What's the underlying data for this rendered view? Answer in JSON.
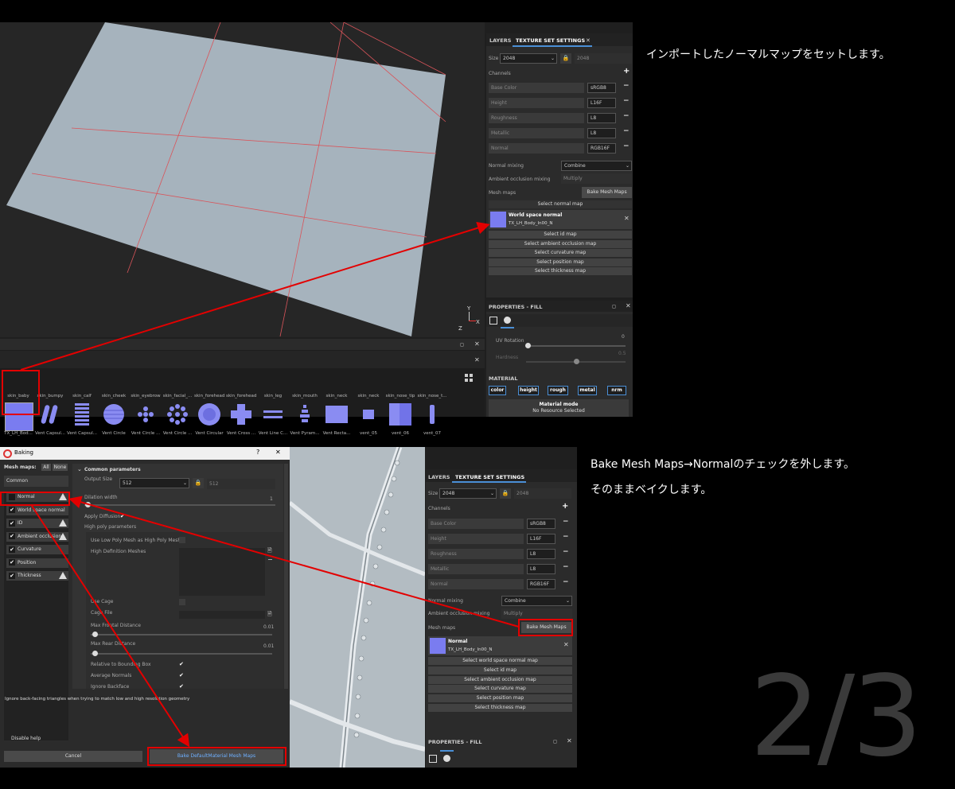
{
  "top_shot": {
    "ts_panel": {
      "tabs": [
        "LAYERS",
        "TEXTURE SET SETTINGS"
      ],
      "close_glyph": "✕",
      "size_label": "Size",
      "size_value": "2048",
      "size_linked": "2048",
      "channels_label": "Channels",
      "add_glyph": "+",
      "channels": [
        {
          "name": "Base Color",
          "format": "sRGB8"
        },
        {
          "name": "Height",
          "format": "L16F"
        },
        {
          "name": "Roughness",
          "format": "L8"
        },
        {
          "name": "Metallic",
          "format": "L8"
        },
        {
          "name": "Normal",
          "format": "RGB16F"
        }
      ],
      "normal_mixing_label": "Normal mixing",
      "normal_mixing_value": "Combine",
      "ao_mixing_label": "Ambient occlusion mixing",
      "ao_mixing_value": "Multiply",
      "mesh_maps_label": "Mesh maps",
      "bake_button": "Bake Mesh Maps",
      "select_normal": "Select normal map",
      "world_space_title": "World space normal",
      "world_space_file": "TX_LH_Body_In00_N",
      "map_buttons": [
        "Select id map",
        "Select ambient occlusion map",
        "Select curvature map",
        "Select position map",
        "Select thickness map"
      ]
    },
    "props": {
      "title": "PROPERTIES - FILL",
      "uv_rotation_label": "UV Rotation",
      "uv_rotation_value": "0",
      "hardness_label": "Hardness",
      "hardness_value": "0.5",
      "material_label": "MATERIAL",
      "material_buttons": [
        "color",
        "height",
        "rough",
        "metal",
        "nrm"
      ],
      "material_mode_label": "Material mode",
      "no_resource": "No Resource Selected"
    },
    "shelf": {
      "names": [
        "skin_baby",
        "skin_bumpy",
        "skin_calf",
        "skin_cheek",
        "skin_eyebrow",
        "skin_facial_...",
        "skin_forehead",
        "skin_forehead",
        "skin_leg",
        "skin_mouth",
        "skin_neck",
        "skin_neck",
        "skin_nose_tip",
        "skin_nose_t..."
      ],
      "captions": [
        "TX_LH_Bod...",
        "Vent Capsul...",
        "Vent Capsul...",
        "Vent Circle",
        "Vent Circle ...",
        "Vent Circle ...",
        "Vent Circular",
        "Vent Cross ...",
        "Vent Line C...",
        "Vent Pyram...",
        "Vent Recta...",
        "vent_05",
        "vent_06",
        "vent_07"
      ]
    },
    "axis": {
      "y": "Y",
      "x": "X",
      "z": "Z"
    },
    "note": "インポートしたノーマルマップをセットします。"
  },
  "bottom_shot": {
    "baking": {
      "title": "Baking",
      "help_glyph": "?",
      "close_glyph": "✕",
      "mesh_maps_label": "Mesh maps:",
      "all_label": "All",
      "none_label": "None",
      "common_item": "Common",
      "maps": [
        "Normal",
        "World space normal",
        "ID",
        "Ambient occlusion",
        "Curvature",
        "Position",
        "Thickness"
      ],
      "common_params_title": "Common parameters",
      "output_size_label": "Output Size",
      "output_size_value": "512",
      "output_size_linked": "512",
      "dilation_label": "Dilation width",
      "dilation_value": "1",
      "apply_diffusion_label": "Apply Diffusion",
      "high_poly_label": "High poly parameters",
      "low_as_high_label": "Use Low Poly Mesh as High Poly Mesh",
      "hd_meshes_label": "High Definition Meshes",
      "use_cage_label": "Use Cage",
      "cage_file_label": "Cage File",
      "max_frontal_label": "Max Frontal Distance",
      "max_frontal_value": "0.01",
      "max_rear_label": "Max Rear Distance",
      "max_rear_value": "0.01",
      "relative_bbox_label": "Relative to Bounding Box",
      "average_normals_label": "Average Normals",
      "ignore_backface_label": "Ignore Backface",
      "help_text": "Ignore back-facing triangles when trying to match low and high resolution geometry",
      "disable_help": "Disable help",
      "cancel": "Cancel",
      "bake_button": "Bake DefaultMaterial Mesh Maps"
    },
    "ts_panel": {
      "tabs": [
        "LAYERS",
        "TEXTURE SET SETTINGS"
      ],
      "size_label": "Size",
      "size_value": "2048",
      "size_linked": "2048",
      "channels_label": "Channels",
      "channels": [
        {
          "name": "Base Color",
          "format": "sRGB8"
        },
        {
          "name": "Height",
          "format": "L16F"
        },
        {
          "name": "Roughness",
          "format": "L8"
        },
        {
          "name": "Metallic",
          "format": "L8"
        },
        {
          "name": "Normal",
          "format": "RGB16F"
        }
      ],
      "normal_mixing_label": "Normal mixing",
      "normal_mixing_value": "Combine",
      "ao_mixing_label": "Ambient occlusion mixing",
      "ao_mixing_value": "Multiply",
      "mesh_maps_label": "Mesh maps",
      "bake_button": "Bake Mesh Maps",
      "normal_title": "Normal",
      "normal_file": "TX_LH_Body_In00_N",
      "map_buttons": [
        "Select world space normal map",
        "Select id map",
        "Select ambient occlusion map",
        "Select curvature map",
        "Select position map",
        "Select thickness map"
      ],
      "props_title": "PROPERTIES - FILL"
    },
    "note_line1": "Bake Mesh Maps→Normalのチェックを外します。",
    "note_line2": "そのままベイクします。",
    "page_counter": "2/3"
  },
  "colors": {
    "annotation_red": "#e30000",
    "accent_blue": "#4a8fd6",
    "thumb_purple": "#7a7cf0"
  }
}
